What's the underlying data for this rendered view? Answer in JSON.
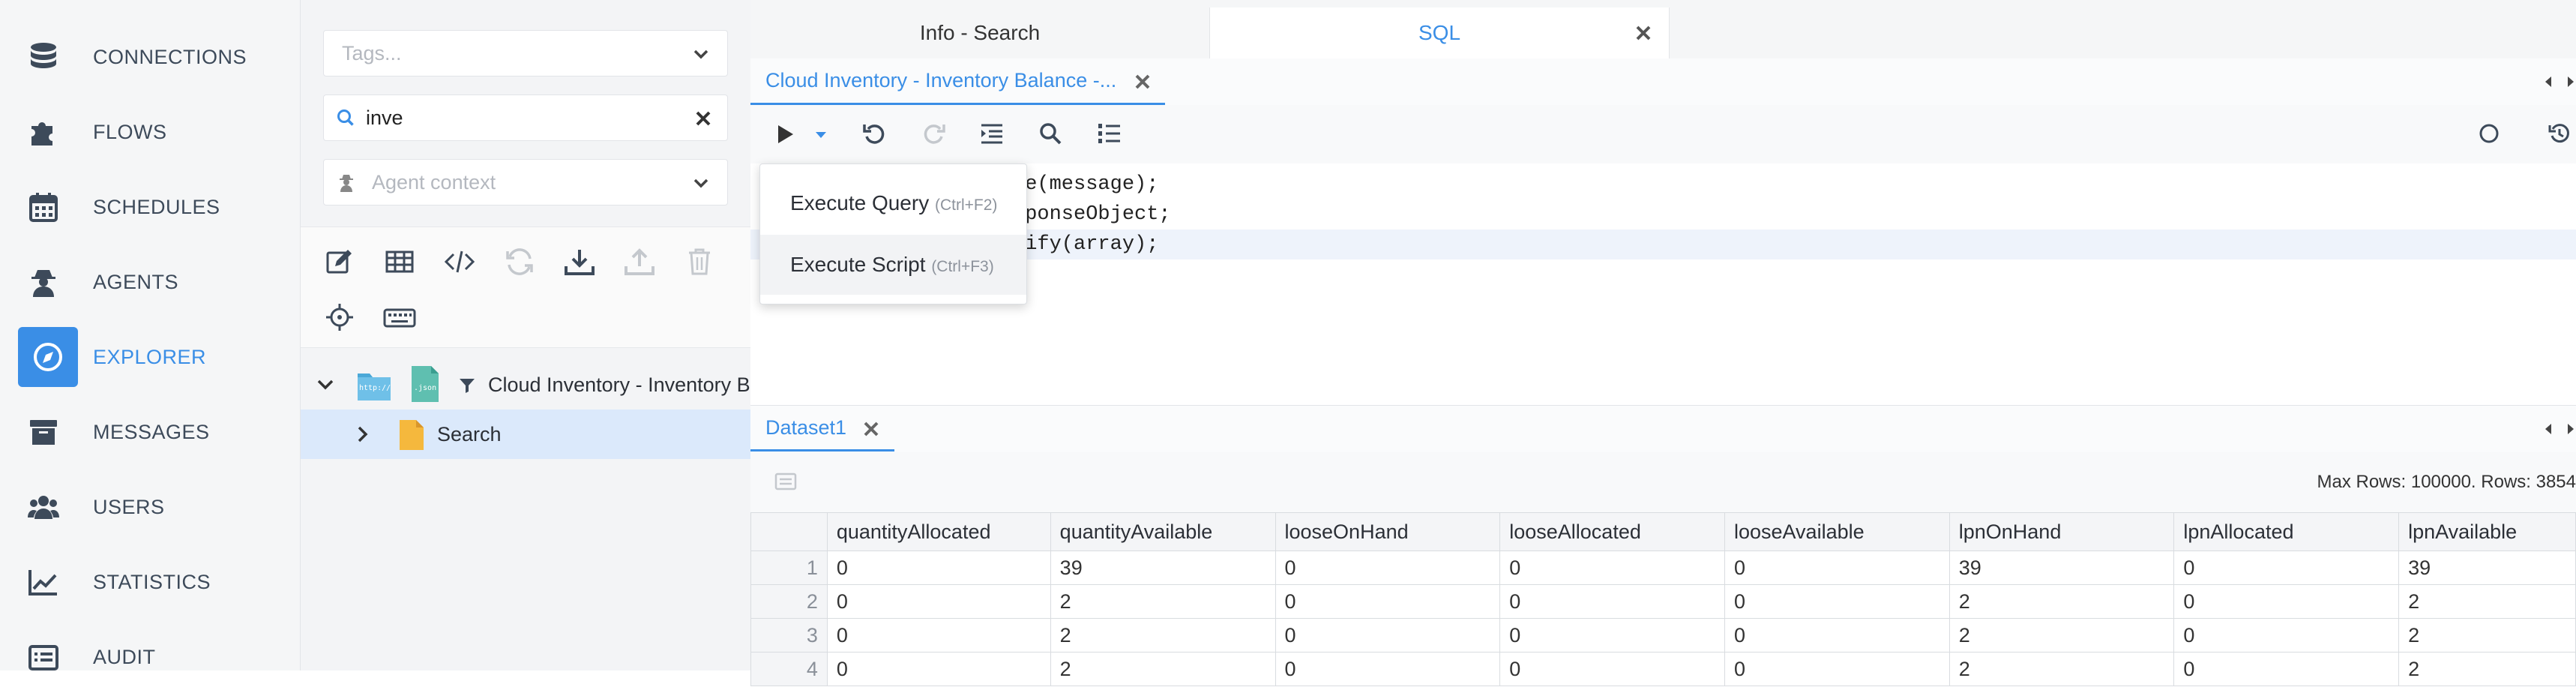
{
  "nav": {
    "items": [
      {
        "label": "CONNECTIONS",
        "icon": "database-icon"
      },
      {
        "label": "FLOWS",
        "icon": "puzzle-icon"
      },
      {
        "label": "SCHEDULES",
        "icon": "calendar-icon"
      },
      {
        "label": "AGENTS",
        "icon": "agent-icon"
      },
      {
        "label": "EXPLORER",
        "icon": "compass-icon",
        "active": true
      },
      {
        "label": "MESSAGES",
        "icon": "archive-icon"
      },
      {
        "label": "USERS",
        "icon": "users-icon"
      },
      {
        "label": "STATISTICS",
        "icon": "chart-line-icon"
      },
      {
        "label": "AUDIT",
        "icon": "list-icon"
      }
    ]
  },
  "filters": {
    "tags_placeholder": "Tags...",
    "search_value": "inve",
    "agent_placeholder": "Agent context"
  },
  "tree": {
    "root_label": "Cloud Inventory - Inventory B",
    "root_badge_http": "http://",
    "root_badge_json": ".json",
    "child_label": "Search"
  },
  "tabs": {
    "top": [
      {
        "label": "Info - Search",
        "active": false
      },
      {
        "label": "SQL",
        "active": true
      }
    ],
    "sub": "Cloud Inventory - Inventory Balance -..."
  },
  "menu": {
    "items": [
      {
        "label": "Execute Query",
        "shortcut": "(Ctrl+F2)"
      },
      {
        "label": "Execute Script",
        "shortcut": "(Ctrl+F3)"
      }
    ]
  },
  "editor": {
    "lines": [
      "se(message);",
      "sponseObject;",
      "gify(array);"
    ]
  },
  "dataset": {
    "tab": "Dataset1",
    "rows_info": "Max Rows: 100000. Rows: 3854",
    "columns": [
      "quantityAllocated",
      "quantityAvailable",
      "looseOnHand",
      "looseAllocated",
      "looseAvailable",
      "lpnOnHand",
      "lpnAllocated",
      "lpnAvailable"
    ],
    "rows": [
      {
        "n": "1",
        "cells": [
          "0",
          "39",
          "0",
          "0",
          "0",
          "39",
          "0",
          "39"
        ]
      },
      {
        "n": "2",
        "cells": [
          "0",
          "2",
          "0",
          "0",
          "0",
          "2",
          "0",
          "2"
        ]
      },
      {
        "n": "3",
        "cells": [
          "0",
          "2",
          "0",
          "0",
          "0",
          "2",
          "0",
          "2"
        ]
      },
      {
        "n": "4",
        "cells": [
          "0",
          "2",
          "0",
          "0",
          "0",
          "2",
          "0",
          "2"
        ]
      }
    ]
  },
  "colors": {
    "accent": "#3a8ee6",
    "selection": "#dbe9fb",
    "nav_text": "#3d4a5a"
  }
}
